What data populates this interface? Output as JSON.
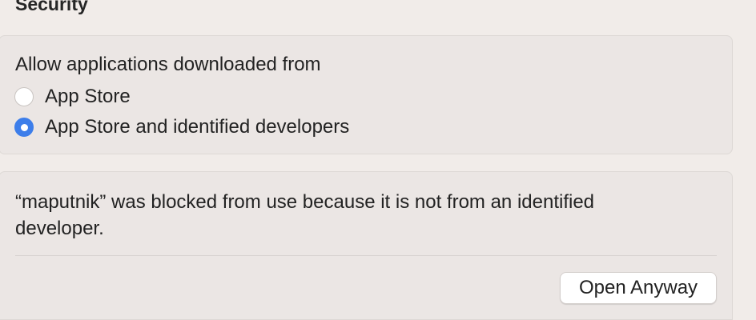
{
  "section": {
    "title": "Security"
  },
  "allow_panel": {
    "heading": "Allow applications downloaded from",
    "options": [
      {
        "label": "App Store",
        "selected": false
      },
      {
        "label": "App Store and identified developers",
        "selected": true
      }
    ]
  },
  "blocked_panel": {
    "message": "“maputnik” was blocked from use because it is not from an identified developer.",
    "open_anyway_label": "Open Anyway"
  },
  "colors": {
    "accent": "#3d7eea",
    "background": "#f1ece9",
    "panel": "#ebe6e4"
  }
}
